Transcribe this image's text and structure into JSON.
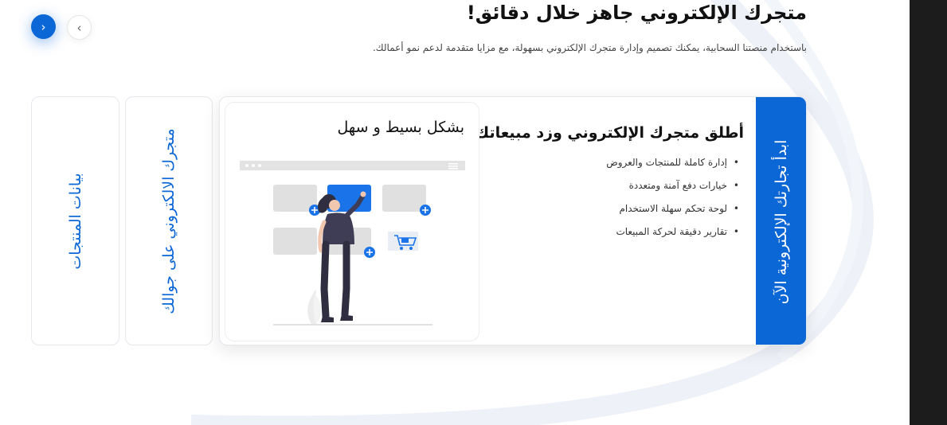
{
  "header": {
    "title": "متجرك الإلكتروني جاهز خلال دقائق!",
    "subtitle": "باستخدام منصتنا السحابية، يمكنك تصميم وإدارة متجرك الإلكتروني بسهولة، مع مزايا متقدمة لدعم نمو أعمالك."
  },
  "carousel": {
    "next_icon": "›",
    "prev_icon": "‹"
  },
  "cards": {
    "products_label": "بيانات المنتجات",
    "mobile_label": "متجرك الالكتروني على جوالك",
    "main": {
      "tab_label": "ابدأ تجارتك الإلكترونية الآن",
      "features_title": "أطلق متجرك الإلكتروني وزد مبيعاتك !",
      "features": [
        "إدارة كاملة للمنتجات والعروض",
        "خيارات دفع آمنة ومتعددة",
        "لوحة تحكم سهلة الاستخدام",
        "تقارير دقيقة لحركة المبيعات"
      ],
      "illustration_title": "بشكل بسيط و سهل"
    }
  },
  "colors": {
    "accent": "#0b66d6",
    "dark_strip": "#1c1c1c"
  }
}
